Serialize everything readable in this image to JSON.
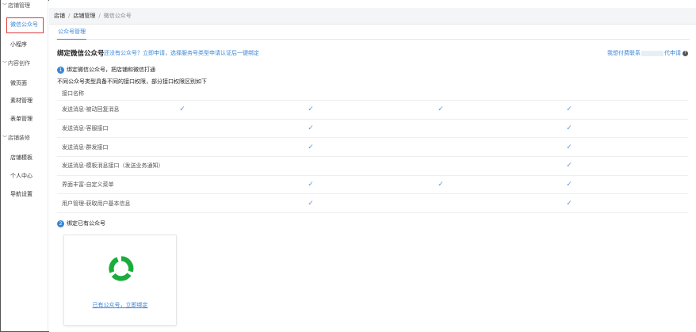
{
  "sidebar": {
    "groups": [
      {
        "title": "店铺管理",
        "items": [
          "微信公众号",
          "小程序"
        ]
      },
      {
        "title": "内容创作",
        "items": [
          "微页面",
          "素材管理",
          "表单管理"
        ]
      },
      {
        "title": "店铺装修",
        "items": [
          "店铺模板",
          "个人中心",
          "导航设置"
        ]
      }
    ],
    "active_item": "微信公众号"
  },
  "breadcrumb": [
    "店铺",
    "店铺管理",
    "微信公众号"
  ],
  "tabs": [
    {
      "label": "公众号管理",
      "active": true
    }
  ],
  "bind": {
    "title": "绑定微信公众号",
    "tip": "还没有公众号？立即申请，选择服务号类型申请认证后一键绑定",
    "help": {
      "prefix": "我想付费联系",
      "suffix": "代申请"
    }
  },
  "step1": {
    "num": "1",
    "text": "绑定微信公众号，把店铺和微信打通"
  },
  "step1_note": "不同公众号类型具备不同的接口权限，部分接口权限区别如下",
  "table": {
    "header": "接口名称",
    "rows": [
      {
        "name": "发送消息-被动回复消息",
        "checks": [
          true,
          true,
          true,
          true
        ]
      },
      {
        "name": "发送消息-客服接口",
        "checks": [
          false,
          true,
          false,
          true
        ]
      },
      {
        "name": "发送消息-群发接口",
        "checks": [
          false,
          true,
          false,
          true
        ]
      },
      {
        "name": "发送消息-模板消息接口（发送业务通知）",
        "checks": [
          false,
          false,
          false,
          true
        ]
      },
      {
        "name": "界面丰富-自定义菜单",
        "checks": [
          false,
          true,
          true,
          true
        ]
      },
      {
        "name": "用户管理-获取用户基本信息",
        "checks": [
          false,
          true,
          false,
          true
        ]
      }
    ]
  },
  "step2": {
    "num": "2",
    "text": "绑定已有公众号"
  },
  "card": {
    "link": "已有公众号，立即绑定"
  },
  "colors": {
    "accent": "#3a86d6",
    "active_border": "#e03b3b",
    "logo_green": "#1aad3b"
  },
  "icons": {
    "check": "check-icon",
    "help": "question-circle-icon",
    "logo": "wechat-official-account-logo"
  }
}
